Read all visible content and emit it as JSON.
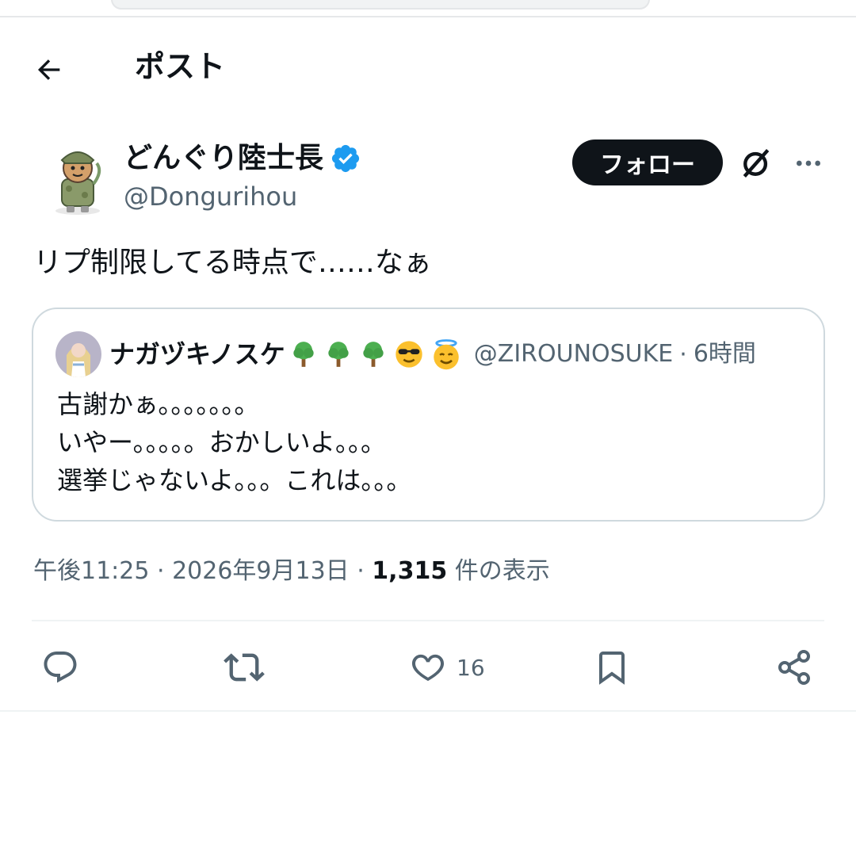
{
  "header": {
    "back_icon": "arrow-left-icon",
    "title": "ポスト"
  },
  "author": {
    "display_name": "どんぐり陸士長",
    "verified": true,
    "handle": "@Dongurihou",
    "follow_label": "フォロー",
    "grok_icon": "grok-icon",
    "more_icon": "more-horizontal-icon"
  },
  "post": {
    "text": "リプ制限してる時点で……なぁ"
  },
  "quote": {
    "name": "ナガヅキノスケ",
    "name_emojis": [
      "tree-icon",
      "tree-icon",
      "tree-icon",
      "sunglasses-face-icon",
      "halo-face-icon"
    ],
    "handle": "@ZIROUNOSUKE",
    "separator": "·",
    "time": "6時間",
    "lines": [
      "古謝かぁ。。。。。。。",
      "いやー。。。。。おかしいよ。。。",
      "選挙じゃないよ。。。これは。。。"
    ]
  },
  "meta": {
    "time": "午後11:25",
    "sep1": " · ",
    "date": "2026年9月13日",
    "sep2": " · ",
    "views": "1,315",
    "views_suffix": " 件の表示"
  },
  "actions": {
    "reply_count": "",
    "repost_count": "",
    "like_count": "16",
    "bookmark_count": "",
    "icons": [
      "reply-icon",
      "repost-icon",
      "like-icon",
      "bookmark-icon",
      "share-icon"
    ]
  },
  "colors": {
    "text_primary": "#0f1419",
    "text_secondary": "#536471",
    "verified_blue": "#1d9bf0",
    "border": "#cfd9de",
    "follow_bg": "#0f1419"
  }
}
